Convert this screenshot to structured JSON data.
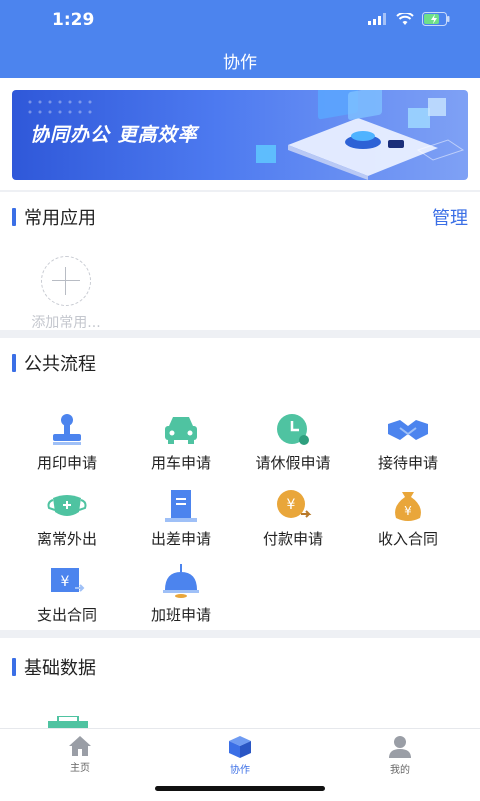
{
  "status": {
    "time": "1:29"
  },
  "nav": {
    "title": "协作"
  },
  "banner": {
    "text": "协同办公  更高效率"
  },
  "common_apps": {
    "title": "常用应用",
    "manage_label": "管理",
    "add_label": "添加常用..."
  },
  "public_flow": {
    "title": "公共流程",
    "items": [
      {
        "label": "用印申请",
        "icon": "seal-icon"
      },
      {
        "label": "用车申请",
        "icon": "car-icon"
      },
      {
        "label": "请休假申请",
        "icon": "clock-icon"
      },
      {
        "label": "接待申请",
        "icon": "handshake-icon"
      },
      {
        "label": "离常外出",
        "icon": "mask-icon"
      },
      {
        "label": "出差申请",
        "icon": "building-icon"
      },
      {
        "label": "付款申请",
        "icon": "payment-icon"
      },
      {
        "label": "收入合同",
        "icon": "money-bag-icon"
      },
      {
        "label": "支出合同",
        "icon": "expense-icon"
      },
      {
        "label": "加班申请",
        "icon": "lamp-icon"
      }
    ]
  },
  "basic_data": {
    "title": "基础数据"
  },
  "tabbar": {
    "items": [
      {
        "label": "主页",
        "icon": "home-icon"
      },
      {
        "label": "协作",
        "icon": "cube-icon",
        "active": true
      },
      {
        "label": "我的",
        "icon": "user-icon"
      }
    ]
  },
  "colors": {
    "primary": "#4c84ee",
    "accent": "#3b6fe6",
    "teal": "#4fc3a1",
    "orange": "#e9a63a"
  }
}
